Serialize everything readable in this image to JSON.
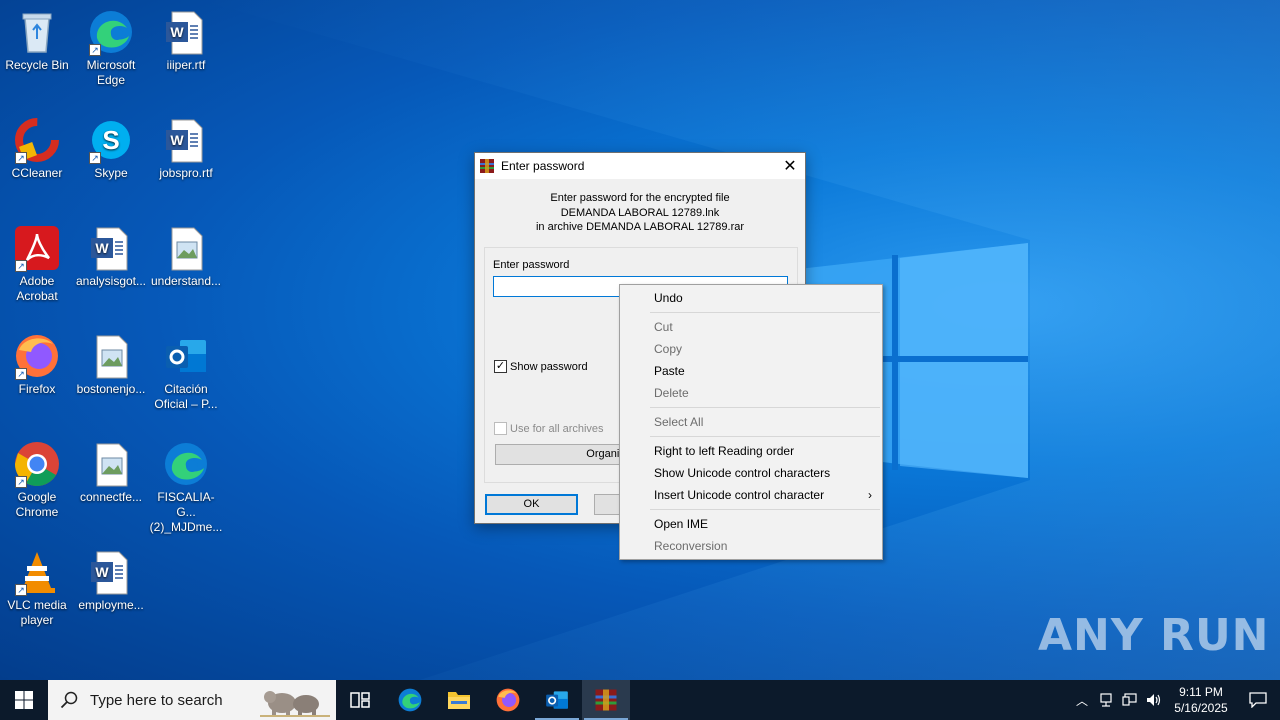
{
  "desktop": {
    "icons": [
      {
        "label": "Recycle Bin",
        "icon": "recycle-bin-icon"
      },
      {
        "label": "Microsoft Edge",
        "icon": "edge-icon"
      },
      {
        "label": "iiiper.rtf",
        "icon": "word-doc-icon"
      },
      {
        "label": "CCleaner",
        "icon": "ccleaner-icon"
      },
      {
        "label": "Skype",
        "icon": "skype-icon"
      },
      {
        "label": "jobspro.rtf",
        "icon": "word-doc-icon"
      },
      {
        "label": "Adobe Acrobat",
        "icon": "acrobat-icon"
      },
      {
        "label": "analysisgot...",
        "icon": "word-doc-icon"
      },
      {
        "label": "understand...",
        "icon": "image-file-icon"
      },
      {
        "label": "Firefox",
        "icon": "firefox-icon"
      },
      {
        "label": "bostonenjo...",
        "icon": "image-file-icon"
      },
      {
        "label": "Citación Oficial – P...",
        "icon": "outlook-icon"
      },
      {
        "label": "Google Chrome",
        "icon": "chrome-icon"
      },
      {
        "label": "connectfe...",
        "icon": "image-file-icon"
      },
      {
        "label": "FISCALIA-G...(2)_MJDme...",
        "icon": "edge-icon"
      },
      {
        "label": "VLC media player",
        "icon": "vlc-icon"
      },
      {
        "label": "employme...",
        "icon": "word-doc-icon"
      }
    ],
    "icon_labels": {
      "recycle": "Recycle Bin",
      "edge_a": "Microsoft",
      "edge_b": "Edge",
      "iiiper": "iiiper.rtf",
      "ccleaner": "CCleaner",
      "skype": "Skype",
      "jobspro": "jobspro.rtf",
      "acrobat_a": "Adobe",
      "acrobat_b": "Acrobat",
      "analysis": "analysisgot...",
      "understand": "understand...",
      "firefox": "Firefox",
      "boston": "bostonenjo...",
      "citacion_a": "Citación",
      "citacion_b": "Oficial – P...",
      "chrome_a": "Google",
      "chrome_b": "Chrome",
      "connect": "connectfe...",
      "fiscalia_a": "FISCALIA-G...",
      "fiscalia_b": "(2)_MJDme...",
      "vlc_a": "VLC media",
      "vlc_b": "player",
      "employ": "employme..."
    },
    "watermark": "ANY RUN"
  },
  "dialog": {
    "title": "Enter password",
    "info_line1": "Enter password for the encrypted file",
    "info_line2": "DEMANDA LABORAL 12789.lnk",
    "info_line3": "in archive DEMANDA LABORAL 12789.rar",
    "password_label": "Enter password",
    "password_value": "",
    "show_password_label": "Show password",
    "show_password_checked": true,
    "use_for_all_label": "Use for all archives",
    "organize_label": "Organize passwords...",
    "ok_label": "OK",
    "cancel_label": "Cancel"
  },
  "context_menu": {
    "undo": "Undo",
    "cut": "Cut",
    "copy": "Copy",
    "paste": "Paste",
    "delete": "Delete",
    "select_all": "Select All",
    "rtl": "Right to left Reading order",
    "show_unicode": "Show Unicode control characters",
    "insert_unicode": "Insert Unicode control character",
    "open_ime": "Open IME",
    "reconversion": "Reconversion"
  },
  "taskbar": {
    "search_placeholder": "Type here to search",
    "pinned": [
      "task-view-icon",
      "edge-icon",
      "file-explorer-icon",
      "firefox-icon",
      "outlook-icon",
      "winrar-icon"
    ],
    "time": "9:11 PM",
    "date": "5/16/2025"
  },
  "colors": {
    "accent": "#0078d7",
    "taskbar": "#0c1a2b",
    "desktop_blue": "#0a78d8"
  }
}
